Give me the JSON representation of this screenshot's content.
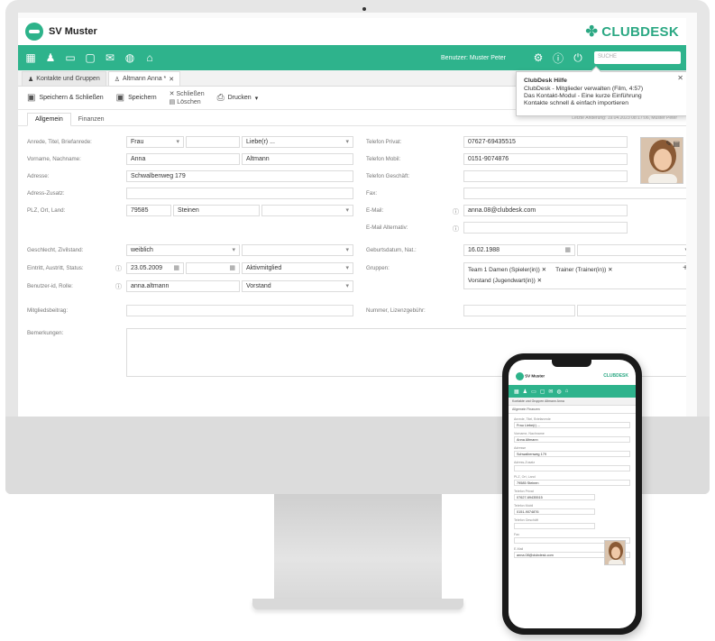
{
  "app": {
    "club_name": "SV Muster",
    "brand": "CLUBDESK"
  },
  "toolbar": {
    "icons": [
      "grid-icon",
      "contacts-icon",
      "calendar-icon",
      "folder-icon",
      "mail-icon",
      "globe-icon",
      "bank-icon"
    ],
    "user_label": "Benutzer: Muster Peter",
    "search_placeholder": "SUCHE"
  },
  "tabs": [
    {
      "label": "Kontakte und Gruppen"
    },
    {
      "label": "Altmann Anna *"
    }
  ],
  "actions": {
    "save_close": "Speichern & Schließen",
    "save": "Speichern",
    "close": "Schließen",
    "delete": "Löschen",
    "print": "Drucken"
  },
  "subtabs": [
    {
      "label": "Allgemein"
    },
    {
      "label": "Finanzen"
    }
  ],
  "last_change": "Letzte Änderung: 19.04.2023 08:17:06, Muster Peter",
  "help": {
    "title": "ClubDesk Hilfe",
    "line1": "ClubDesk - Mitglieder verwalten (Film, 4:57)",
    "line2": "Das Kontakt-Modul - Eine kurze Einführung",
    "line3": "Kontakte schnell & einfach importieren"
  },
  "form": {
    "labels": {
      "salutation": "Anrede, Titel, Briefanrede:",
      "name": "Vorname, Nachname:",
      "address": "Adresse:",
      "address_extra": "Adress-Zusatz:",
      "zip_city": "PLZ, Ort, Land:",
      "gender": "Geschlecht, Zivilstand:",
      "entry": "Eintritt, Austritt, Status:",
      "userid": "Benutzer-id, Rolle:",
      "fee": "Mitgliedsbeitrag:",
      "remarks": "Bemerkungen:",
      "phone_private": "Telefon Privat:",
      "phone_mobile": "Telefon Mobil:",
      "phone_business": "Telefon Geschäft:",
      "fax": "Fax:",
      "email": "E-Mail:",
      "email_alt": "E-Mail Alternativ:",
      "birthdate": "Geburtsdatum, Nat.:",
      "groups": "Gruppen:",
      "license": "Nummer, Lizenzgebühr:"
    },
    "values": {
      "salutation": "Frau",
      "letter_salutation": "Liebe(r) ...",
      "first_name": "Anna",
      "last_name": "Altmann",
      "address": "Schwalbenweg 179",
      "zip": "79585",
      "city": "Steinen",
      "gender": "weiblich",
      "entry_date": "23.05.2009",
      "status": "Aktivmitglied",
      "userid": "anna.altmann",
      "role": "Vorstand",
      "phone_private": "07627-69435515",
      "phone_mobile": "0151-9074876",
      "email": "anna.08@clubdesk.com",
      "birthdate": "16.02.1988"
    },
    "groups": [
      "Team 1 Damen (Spieler(in))",
      "Trainer (Trainer(in))",
      "Vorstand (Jugendwart(in))"
    ]
  },
  "phone": {
    "brand": "SV Muster",
    "club": "CLUBDESK",
    "tabs": "Kontakte und Gruppen   Altmann Anna",
    "subtabs": "Allgemein     Finanzen",
    "fields": [
      {
        "label": "Anrede, Titel, Briefanrede",
        "value": "Frau                     Liebe(r) ..."
      },
      {
        "label": "Vorname, Nachname",
        "value": "Anna                    Altmann"
      },
      {
        "label": "Adresse",
        "value": "Schwalbenweg 179"
      },
      {
        "label": "Adress-Zusatz",
        "value": ""
      },
      {
        "label": "PLZ, Ort, Land",
        "value": "79585    Steinen"
      },
      {
        "label": "Telefon Privat",
        "value": "07627-69435515"
      },
      {
        "label": "Telefon Mobil",
        "value": "0151-9074876"
      },
      {
        "label": "Telefon Geschäft",
        "value": ""
      },
      {
        "label": "Fax",
        "value": ""
      },
      {
        "label": "E-Mail",
        "value": "anna.08@clubdesk.com"
      }
    ]
  }
}
